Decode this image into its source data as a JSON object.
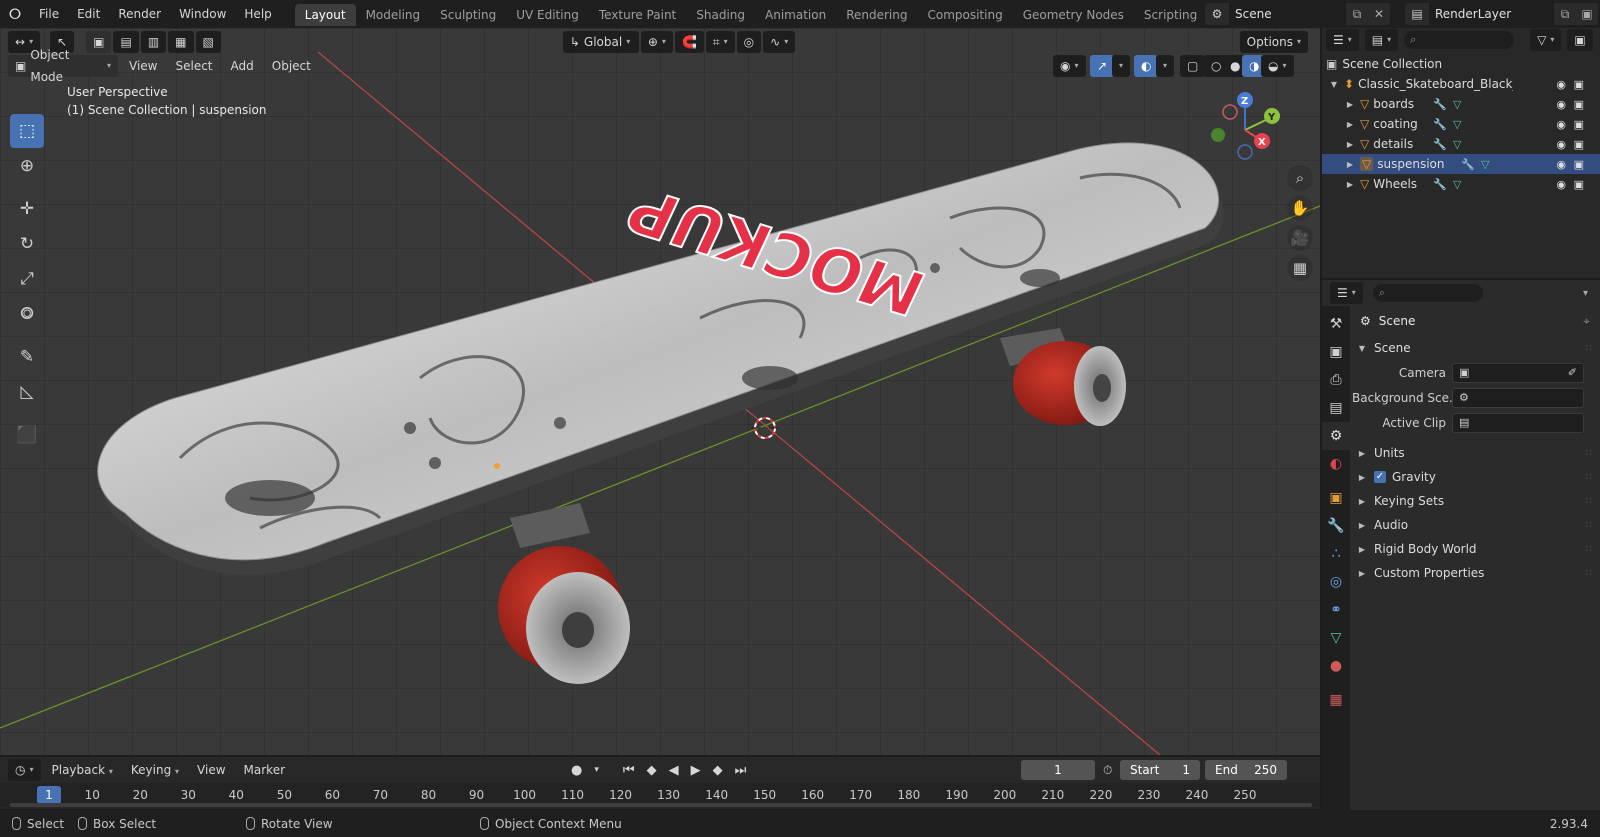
{
  "menu": {
    "logo": "blender-logo-icon",
    "items": [
      "File",
      "Edit",
      "Render",
      "Window",
      "Help"
    ]
  },
  "workspaces": {
    "tabs": [
      "Layout",
      "Modeling",
      "Sculpting",
      "UV Editing",
      "Texture Paint",
      "Shading",
      "Animation",
      "Rendering",
      "Compositing",
      "Geometry Nodes",
      "Scripting"
    ],
    "active": "Layout",
    "add": "+"
  },
  "scene_field": {
    "value": "Scene"
  },
  "view_layer_field": {
    "value": "RenderLayer"
  },
  "viewport": {
    "transform_orientation": "Global",
    "options": "Options",
    "mode": "Object Mode",
    "menus": [
      "View",
      "Select",
      "Add",
      "Object"
    ],
    "info_line1": "User Perspective",
    "info_line2": "(1) Scene Collection | suspension",
    "deck_text": "MOCKUP",
    "gizmo": {
      "z": "Z",
      "y": "Y",
      "x": "X"
    }
  },
  "outliner": {
    "root": "Scene Collection",
    "collection": "Classic_Skateboard_Black_La",
    "objects": [
      {
        "name": "boards",
        "selected": false
      },
      {
        "name": "coating",
        "selected": false
      },
      {
        "name": "details",
        "selected": false
      },
      {
        "name": "suspension",
        "selected": true
      },
      {
        "name": "Wheels",
        "selected": false
      }
    ]
  },
  "properties": {
    "title": "Scene",
    "panel": "Scene",
    "fields": [
      {
        "label": "Camera",
        "value": ""
      },
      {
        "label": "Background Sce...",
        "value": ""
      },
      {
        "label": "Active Clip",
        "value": ""
      }
    ],
    "collapsed_panels": [
      "Units",
      "Gravity",
      "Keying Sets",
      "Audio",
      "Rigid Body World",
      "Custom Properties"
    ]
  },
  "timeline": {
    "menus": [
      "Playback",
      "Keying",
      "View",
      "Marker"
    ],
    "current_frame": "1",
    "start_label": "Start",
    "start": "1",
    "end_label": "End",
    "end": "250",
    "ticks": [
      "1",
      "10",
      "20",
      "30",
      "40",
      "50",
      "60",
      "70",
      "80",
      "90",
      "100",
      "110",
      "120",
      "130",
      "140",
      "150",
      "160",
      "170",
      "180",
      "190",
      "200",
      "210",
      "220",
      "230",
      "240",
      "250"
    ]
  },
  "statusbar": {
    "select": "Select",
    "box_select": "Box Select",
    "rotate_view": "Rotate View",
    "context_menu": "Object Context Menu",
    "version": "2.93.4"
  }
}
